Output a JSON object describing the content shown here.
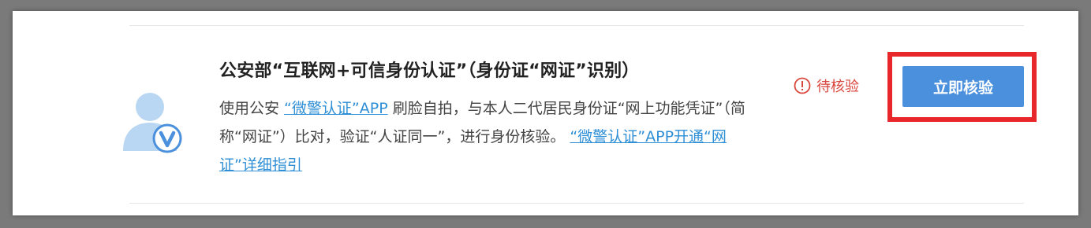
{
  "card": {
    "title": "公安部“互联网+可信身份认证”（身份证“网证”识别）",
    "desc_part1": "使用公安 ",
    "desc_link1": "“微警认证”APP",
    "desc_part2": " 刷脸自拍，与本人二代居民身份证“网上功能凭证”（简称“网证”）比对，验证“人证同一”，进行身份核验。 ",
    "desc_link2": "“微警认证”APP开通“网证”详细指引",
    "avatar_icon": "verified-user-icon",
    "status_icon": "exclamation-circle-icon",
    "status_text": "待核验",
    "button_label": "立即核验"
  },
  "colors": {
    "accent_blue": "#4a90dc",
    "link_blue": "#2f8fd6",
    "status_red": "#d9463c",
    "highlight_red": "#e8272a"
  }
}
